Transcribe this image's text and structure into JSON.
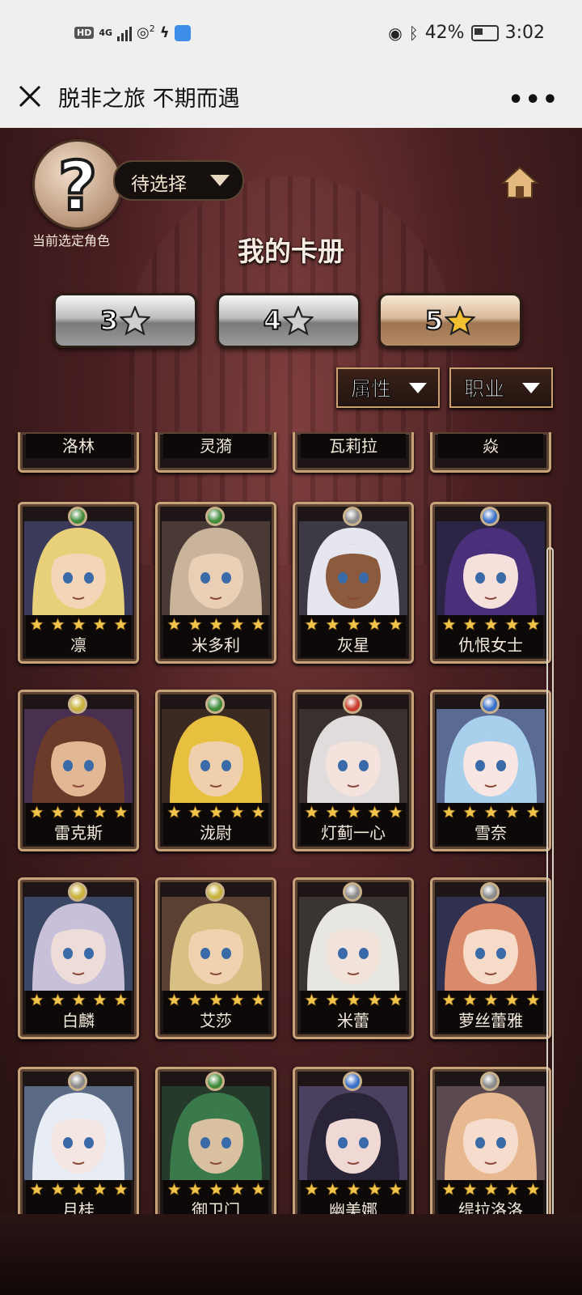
{
  "status_bar": {
    "network": "4G",
    "sim": "2",
    "hd": "HD",
    "battery": "42%",
    "time": "3:02"
  },
  "titlebar": {
    "title": "脱非之旅 不期而遇",
    "more": "•••"
  },
  "header": {
    "selector_label": "待选择",
    "current_label": "当前选定角色",
    "page_title": "我的卡册",
    "question_mark": "?"
  },
  "star_tabs": [
    {
      "label": "3",
      "active": false
    },
    {
      "label": "4",
      "active": false
    },
    {
      "label": "5",
      "active": true
    }
  ],
  "filters": {
    "attribute": "属性",
    "job": "职业"
  },
  "partial_row": [
    "洛林",
    "灵漪",
    "瓦莉拉",
    "焱"
  ],
  "cards": [
    {
      "name": "凛",
      "element": "#3f8a3a",
      "skin": "#f3d6b8",
      "hair": "#e8cf7a",
      "bg": "#3b3a5a"
    },
    {
      "name": "米多利",
      "element": "#3f8a3a",
      "skin": "#e9cfb5",
      "hair": "#c9b39a",
      "bg": "#4a3a35"
    },
    {
      "name": "灰星",
      "element": "#8a8a8a",
      "skin": "#8c5a3c",
      "hair": "#e6e6ee",
      "bg": "#3e3a45"
    },
    {
      "name": "仇恨女士",
      "element": "#3a6fc8",
      "skin": "#f6e0dc",
      "hair": "#4a2f7a",
      "bg": "#2c2444"
    },
    {
      "name": "雷克斯",
      "element": "#c8b23a",
      "skin": "#e2b894",
      "hair": "#6a3a2a",
      "bg": "#4a3050"
    },
    {
      "name": "泷尉",
      "element": "#3f8a3a",
      "skin": "#f0d0ac",
      "hair": "#e8c040",
      "bg": "#3a2a22"
    },
    {
      "name": "灯蓟一心",
      "element": "#c83a2a",
      "skin": "#f4e2dc",
      "hair": "#e0dcdc",
      "bg": "#3a3030"
    },
    {
      "name": "雪奈",
      "element": "#3a6fc8",
      "skin": "#f8e6e2",
      "hair": "#a8d0ec",
      "bg": "#5a6a90"
    },
    {
      "name": "白麟",
      "element": "#c8b23a",
      "skin": "#eddcd8",
      "hair": "#c8c0d8",
      "bg": "#3a4866"
    },
    {
      "name": "艾莎",
      "element": "#c8b23a",
      "skin": "#f0d2b0",
      "hair": "#d8c084",
      "bg": "#5a4032"
    },
    {
      "name": "米蕾",
      "element": "#8a8a8a",
      "skin": "#f2e4da",
      "hair": "#e8e6e0",
      "bg": "#3a3432"
    },
    {
      "name": "萝丝蕾雅",
      "element": "#8a8a8a",
      "skin": "#f6dcc8",
      "hair": "#d88a6a",
      "bg": "#303050"
    },
    {
      "name": "月桂",
      "element": "#8a8a8a",
      "skin": "#f4e6e2",
      "hair": "#e8ecf4",
      "bg": "#5a6a84"
    },
    {
      "name": "御卫门",
      "element": "#3f8a3a",
      "skin": "#d8c0a0",
      "hair": "#3a7a4a",
      "bg": "#253a2a"
    },
    {
      "name": "幽美娜",
      "element": "#3a6fc8",
      "skin": "#f0d8d4",
      "hair": "#2a2438",
      "bg": "#4a4060"
    },
    {
      "name": "缇拉洛洛",
      "element": "#8a8a8a",
      "skin": "#f6dccc",
      "hair": "#e8b890",
      "bg": "#5a4a50"
    }
  ]
}
